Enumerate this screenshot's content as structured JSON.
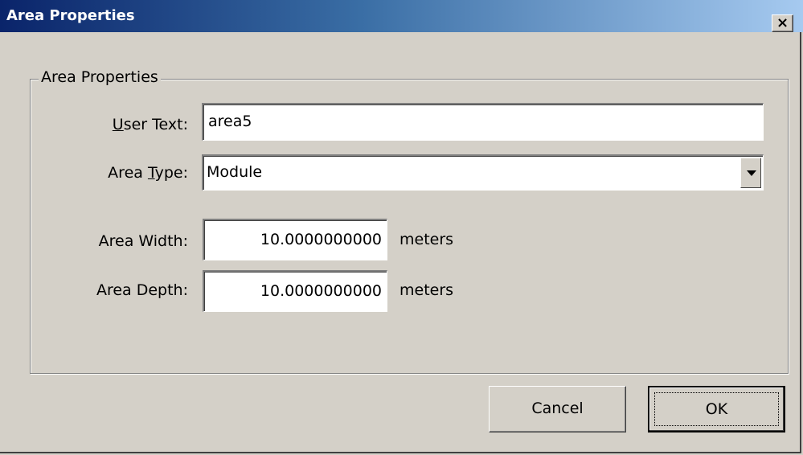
{
  "window": {
    "title": "Area Properties",
    "close_glyph": "×"
  },
  "group": {
    "legend": "Area Properties"
  },
  "fields": {
    "user_text": {
      "label_underline": "U",
      "label_rest": "ser Text:",
      "value": "area5"
    },
    "area_type": {
      "label_pre": "Area ",
      "label_underline": "T",
      "label_rest": "ype:",
      "value": "Module"
    },
    "area_width": {
      "label": "Area Width:",
      "value": "10.0000000000",
      "unit": "meters"
    },
    "area_depth": {
      "label": "Area Depth:",
      "value": "10.0000000000",
      "unit": "meters"
    }
  },
  "buttons": {
    "cancel": "Cancel",
    "ok": "OK"
  },
  "icons": {
    "close": "close-icon",
    "dropdown": "chevron-down-icon"
  }
}
